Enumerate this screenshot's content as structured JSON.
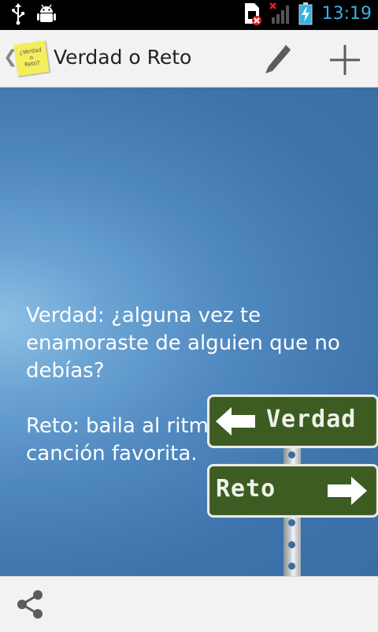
{
  "status_bar": {
    "time": "13:19",
    "icons": [
      "usb-icon",
      "android-debug-icon",
      "sim-card-icon",
      "signal-off-icon",
      "battery-charging-icon"
    ]
  },
  "action_bar": {
    "logo_text": [
      "¿Verdad",
      "o",
      "Reto?"
    ],
    "title": "Verdad o Reto",
    "actions": [
      "edit-icon",
      "add-icon"
    ]
  },
  "content": {
    "truth_text": "Verdad: ¿alguna vez te enamoraste de alguien que no debías?",
    "dare_text": "Reto: baila al ritmo de tu canción favorita."
  },
  "signpost": {
    "truth_label": "Verdad",
    "dare_label": "Reto"
  },
  "bottom_bar": {
    "actions": [
      "share-icon"
    ]
  },
  "colors": {
    "accent": "#38b0e0",
    "content_background": "#4f87bf",
    "sign_green": "#3d5c22"
  }
}
